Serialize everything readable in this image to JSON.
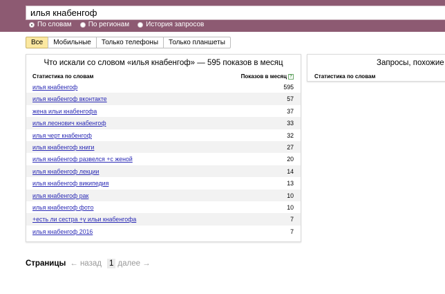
{
  "search": {
    "value": "илья кнабенгоф"
  },
  "modes": [
    {
      "label": "По словам",
      "selected": true
    },
    {
      "label": "По регионам",
      "selected": false
    },
    {
      "label": "История запросов",
      "selected": false
    }
  ],
  "filters": [
    {
      "label": "Все",
      "active": true
    },
    {
      "label": "Мобильные",
      "active": false
    },
    {
      "label": "Только телефоны",
      "active": false
    },
    {
      "label": "Только планшеты",
      "active": false
    }
  ],
  "left_panel": {
    "title": "Что искали со словом «илья кнабенгоф» — 595 показов в месяц",
    "col_phrase": "Статистика по словам",
    "col_count": "Показов в месяц",
    "help_icon": "?",
    "rows": [
      {
        "phrase": "илья кнабенгоф",
        "count": "595"
      },
      {
        "phrase": "илья кнабенгоф вконтакте",
        "count": "57"
      },
      {
        "phrase": "жена ильи кнабенгофа",
        "count": "37"
      },
      {
        "phrase": "илья леонович кнабенгоф",
        "count": "33"
      },
      {
        "phrase": "илья черт кнабенгоф",
        "count": "32"
      },
      {
        "phrase": "илья кнабенгоф книги",
        "count": "27"
      },
      {
        "phrase": "илья кнабенгоф развелся +с женой",
        "count": "20"
      },
      {
        "phrase": "илья кнабенгоф лекции",
        "count": "14"
      },
      {
        "phrase": "илья кнабенгоф википедия",
        "count": "13"
      },
      {
        "phrase": "илья кнабенгоф рак",
        "count": "10"
      },
      {
        "phrase": "илья кнабенгоф фото",
        "count": "10"
      },
      {
        "phrase": "+есть ли сестра +у ильи кнабенгофа",
        "count": "7"
      },
      {
        "phrase": "илья кнабенгоф 2016",
        "count": "7"
      }
    ]
  },
  "right_panel": {
    "title": "Запросы, похожие н",
    "col_phrase": "Статистика по словам"
  },
  "pager": {
    "label": "Страницы",
    "prev": "← назад",
    "current": "1",
    "next": "далее →"
  },
  "colors": {
    "topbar": "#8d5a72",
    "active_tab": "#fbe8a0",
    "link": "#2a2ab5"
  }
}
